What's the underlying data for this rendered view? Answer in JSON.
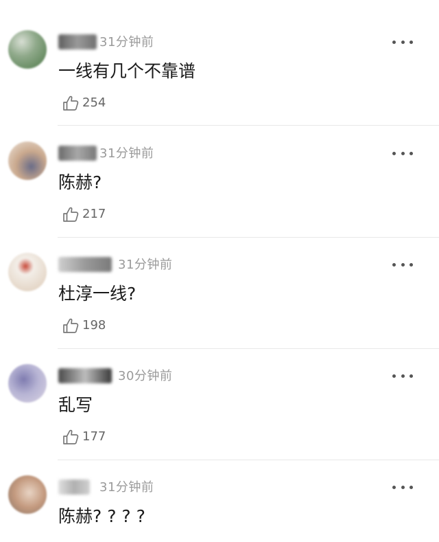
{
  "comments": [
    {
      "time": "31分钟前",
      "text": "一线有几个不靠谱",
      "likes": "254",
      "avatar_colors": [
        "#4f7a4a",
        "#8fa98a",
        "#d7ded3"
      ],
      "name_color": "#6f6f6f"
    },
    {
      "time": "31分钟前",
      "text": "陈赫?",
      "likes": "217",
      "avatar_colors": [
        "#c9a88d",
        "#6b6d88",
        "#ede3d8"
      ],
      "name_color": "#7a7a7a"
    },
    {
      "time": "31分钟前",
      "text": "杜淳一线?",
      "likes": "198",
      "avatar_colors": [
        "#f3eee8",
        "#e3d4c4",
        "#c84a3a"
      ],
      "name_color": "#8a8a8a"
    },
    {
      "time": "30分钟前",
      "text": "乱写",
      "likes": "177",
      "avatar_colors": [
        "#7f7cb0",
        "#b7b4d4",
        "#d9d3e3"
      ],
      "name_color": "#6a6a6a"
    },
    {
      "time": "31分钟前",
      "text": "陈赫? ? ? ?",
      "likes": "",
      "avatar_colors": [
        "#c49a7f",
        "#e8d4c4",
        "#8a7566"
      ],
      "name_color": "#b0b0b0"
    }
  ]
}
